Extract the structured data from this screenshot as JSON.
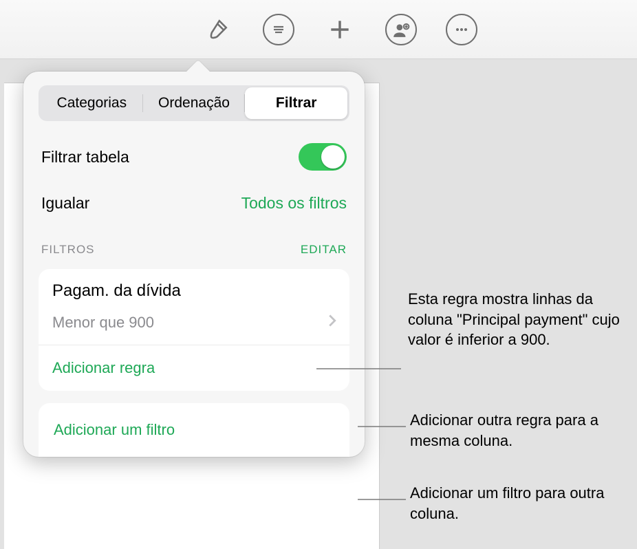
{
  "toolbar": {
    "icons": [
      "brush-icon",
      "list-icon",
      "plus-icon",
      "collaborate-icon",
      "more-icon"
    ]
  },
  "tabs": {
    "categories": "Categorias",
    "sort": "Ordenação",
    "filter": "Filtrar"
  },
  "filter_table_label": "Filtrar tabela",
  "match_label": "Igualar",
  "match_value": "Todos os filtros",
  "section": {
    "label": "FILTROS",
    "edit": "EDITAR"
  },
  "filter_card": {
    "column": "Pagam. da dívida",
    "rule": "Menor que 900",
    "add_rule": "Adicionar regra"
  },
  "add_filter": "Adicionar um filtro",
  "callouts": {
    "c1": "Esta regra mostra linhas da coluna \"Principal payment\" cujo valor é inferior a 900.",
    "c2": "Adicionar outra regra para a mesma coluna.",
    "c3": "Adicionar um filtro para outra coluna."
  }
}
